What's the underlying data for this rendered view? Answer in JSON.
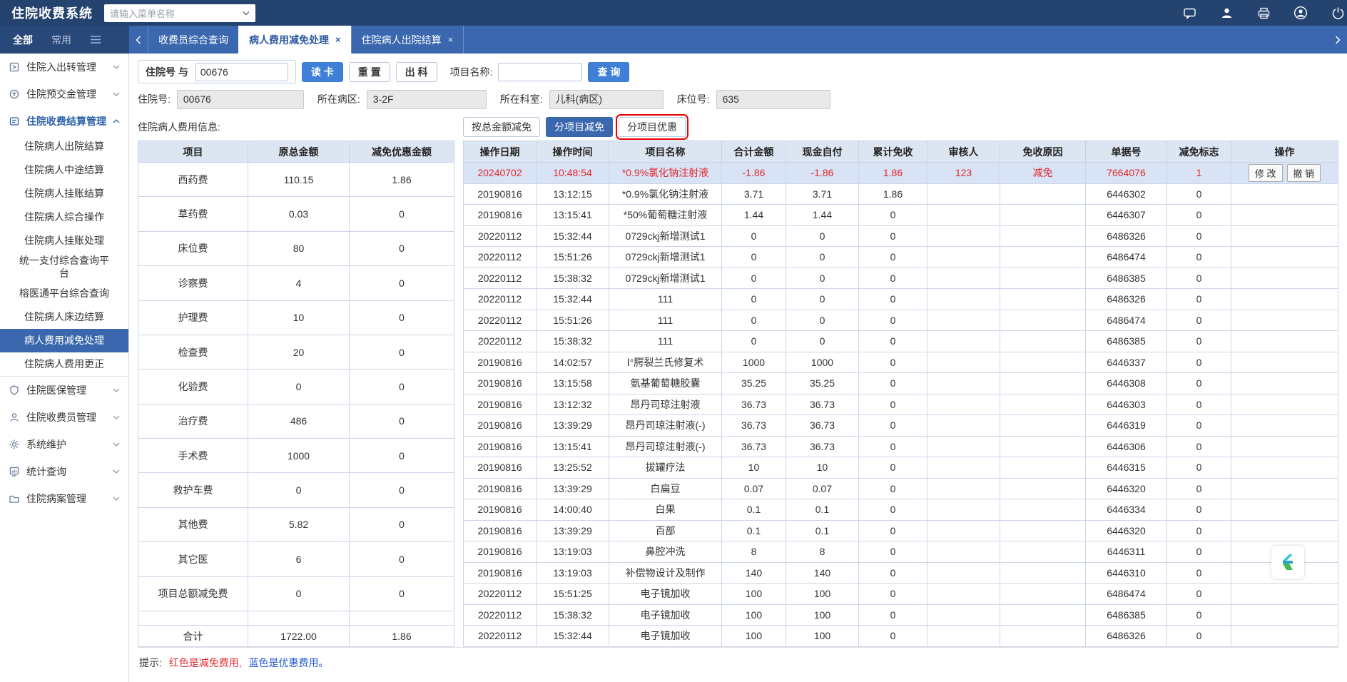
{
  "icons": {
    "close": "×"
  },
  "topbar": {
    "title": "住院收费系统",
    "menu_search_placeholder": "请输入菜单名称",
    "icon_names": [
      "chat-icon",
      "contact-icon",
      "print-icon",
      "user-icon",
      "exit-icon"
    ]
  },
  "tabbar": {
    "filter_tabs": [
      "全部",
      "常用"
    ],
    "tabs": [
      {
        "label": "收费员综合查询",
        "active": false,
        "closable": false
      },
      {
        "label": "病人费用减免处理",
        "active": true,
        "closable": true
      },
      {
        "label": "住院病人出院结算",
        "active": false,
        "closable": true
      }
    ]
  },
  "sidebar": {
    "groups": [
      {
        "label": "住院入出转管理"
      },
      {
        "label": "住院预交金管理"
      },
      {
        "label": "住院收费结算管理",
        "expanded": true
      },
      {
        "label": "住院医保管理"
      },
      {
        "label": "住院收费员管理"
      },
      {
        "label": "系统维护"
      },
      {
        "label": "统计查询"
      },
      {
        "label": "住院病案管理"
      }
    ],
    "subitems": [
      "住院病人出院结算",
      "住院病人中途结算",
      "住院病人挂账结算",
      "住院病人综合操作",
      "住院病人挂账处理",
      "统一支付综合查询平台",
      "榕医通平台综合查询",
      "住院病人床边结算",
      "病人费用减免处理",
      "住院病人费用更正"
    ],
    "active_index": 8
  },
  "toolbar": {
    "admission_label": "住院号 与",
    "admission_value": "00676",
    "read_card": "读 卡",
    "reset": "重 置",
    "discharge": "出 科",
    "item_name_label": "项目名称:",
    "item_name_value": "",
    "query": "查 询"
  },
  "patient": {
    "admission_no_label": "住院号:",
    "admission_no": "00676",
    "ward_label": "所在病区:",
    "ward": "3-2F",
    "dept_label": "所在科室:",
    "dept": "儿科(病区)",
    "bed_label": "床位号:",
    "bed": "635"
  },
  "fee_panel": {
    "title": "住院病人费用信息:",
    "headers": [
      "项目",
      "原总金额",
      "减免优惠金额"
    ],
    "rows": [
      [
        "西药费",
        "110.15",
        "1.86"
      ],
      [
        "草药费",
        "0.03",
        "0"
      ],
      [
        "床位费",
        "80",
        "0"
      ],
      [
        "诊察费",
        "4",
        "0"
      ],
      [
        "护理费",
        "10",
        "0"
      ],
      [
        "检查费",
        "20",
        "0"
      ],
      [
        "化验费",
        "0",
        "0"
      ],
      [
        "治疗费",
        "486",
        "0"
      ],
      [
        "手术费",
        "1000",
        "0"
      ],
      [
        "救护车费",
        "0",
        "0"
      ],
      [
        "其他费",
        "5.82",
        "0"
      ],
      [
        "其它医",
        "6",
        "0"
      ],
      [
        "项目总额减免费",
        "0",
        "0"
      ]
    ],
    "total": [
      "合计",
      "1722.00",
      "1.86"
    ]
  },
  "detail_panel": {
    "mode_buttons": [
      "按总金额减免",
      "分项目减免",
      "分项目优惠"
    ],
    "headers": [
      "操作日期",
      "操作时间",
      "项目名称",
      "合计金额",
      "现金自付",
      "累计免收",
      "审核人",
      "免收原因",
      "单据号",
      "减免标志",
      "操作"
    ],
    "op_labels": [
      "修 改",
      "撤 销"
    ],
    "rows": [
      {
        "selected": true,
        "cells": [
          "20240702",
          "10:48:54",
          "*0.9%氯化钠注射液",
          "-1.86",
          "-1.86",
          "1.86",
          "123",
          "减免",
          "7664076",
          "1"
        ],
        "ops": [
          "修 改",
          "撤 销"
        ]
      },
      {
        "selected": false,
        "cells": [
          "20190816",
          "13:12:15",
          "*0.9%氯化钠注射液",
          "3.71",
          "3.71",
          "1.86",
          "",
          "",
          "6446302",
          "0"
        ],
        "ops": []
      },
      {
        "selected": false,
        "cells": [
          "20190816",
          "13:15:41",
          "*50%葡萄糖注射液",
          "1.44",
          "1.44",
          "0",
          "",
          "",
          "6446307",
          "0"
        ],
        "ops": []
      },
      {
        "selected": false,
        "cells": [
          "20220112",
          "15:32:44",
          "0729ckj新增测试1",
          "0",
          "0",
          "0",
          "",
          "",
          "6486326",
          "0"
        ],
        "ops": []
      },
      {
        "selected": false,
        "cells": [
          "20220112",
          "15:51:26",
          "0729ckj新增测试1",
          "0",
          "0",
          "0",
          "",
          "",
          "6486474",
          "0"
        ],
        "ops": []
      },
      {
        "selected": false,
        "cells": [
          "20220112",
          "15:38:32",
          "0729ckj新增测试1",
          "0",
          "0",
          "0",
          "",
          "",
          "6486385",
          "0"
        ],
        "ops": []
      },
      {
        "selected": false,
        "cells": [
          "20220112",
          "15:32:44",
          "111",
          "0",
          "0",
          "0",
          "",
          "",
          "6486326",
          "0"
        ],
        "ops": []
      },
      {
        "selected": false,
        "cells": [
          "20220112",
          "15:51:26",
          "111",
          "0",
          "0",
          "0",
          "",
          "",
          "6486474",
          "0"
        ],
        "ops": []
      },
      {
        "selected": false,
        "cells": [
          "20220112",
          "15:38:32",
          "111",
          "0",
          "0",
          "0",
          "",
          "",
          "6486385",
          "0"
        ],
        "ops": []
      },
      {
        "selected": false,
        "cells": [
          "20190816",
          "14:02:57",
          "Ⅰ°腭裂兰氏修复术",
          "1000",
          "1000",
          "0",
          "",
          "",
          "6446337",
          "0"
        ],
        "ops": []
      },
      {
        "selected": false,
        "cells": [
          "20190816",
          "13:15:58",
          "氨基葡萄糖胶囊",
          "35.25",
          "35.25",
          "0",
          "",
          "",
          "6446308",
          "0"
        ],
        "ops": []
      },
      {
        "selected": false,
        "cells": [
          "20190816",
          "13:12:32",
          "昂丹司琼注射液",
          "36.73",
          "36.73",
          "0",
          "",
          "",
          "6446303",
          "0"
        ],
        "ops": []
      },
      {
        "selected": false,
        "cells": [
          "20190816",
          "13:39:29",
          "昂丹司琼注射液(-)",
          "36.73",
          "36.73",
          "0",
          "",
          "",
          "6446319",
          "0"
        ],
        "ops": []
      },
      {
        "selected": false,
        "cells": [
          "20190816",
          "13:15:41",
          "昂丹司琼注射液(-)",
          "36.73",
          "36.73",
          "0",
          "",
          "",
          "6446306",
          "0"
        ],
        "ops": []
      },
      {
        "selected": false,
        "cells": [
          "20190816",
          "13:25:52",
          "拔罐疗法",
          "10",
          "10",
          "0",
          "",
          "",
          "6446315",
          "0"
        ],
        "ops": []
      },
      {
        "selected": false,
        "cells": [
          "20190816",
          "13:39:29",
          "白扁豆",
          "0.07",
          "0.07",
          "0",
          "",
          "",
          "6446320",
          "0"
        ],
        "ops": []
      },
      {
        "selected": false,
        "cells": [
          "20190816",
          "14:00:40",
          "白果",
          "0.1",
          "0.1",
          "0",
          "",
          "",
          "6446334",
          "0"
        ],
        "ops": []
      },
      {
        "selected": false,
        "cells": [
          "20190816",
          "13:39:29",
          "百部",
          "0.1",
          "0.1",
          "0",
          "",
          "",
          "6446320",
          "0"
        ],
        "ops": []
      },
      {
        "selected": false,
        "cells": [
          "20190816",
          "13:19:03",
          "鼻腔冲洗",
          "8",
          "8",
          "0",
          "",
          "",
          "6446311",
          "0"
        ],
        "ops": []
      },
      {
        "selected": false,
        "cells": [
          "20190816",
          "13:19:03",
          "补偿物设计及制作",
          "140",
          "140",
          "0",
          "",
          "",
          "6446310",
          "0"
        ],
        "ops": []
      },
      {
        "selected": false,
        "cells": [
          "20220112",
          "15:51:25",
          "电子镜加收",
          "100",
          "100",
          "0",
          "",
          "",
          "6486474",
          "0"
        ],
        "ops": []
      },
      {
        "selected": false,
        "cells": [
          "20220112",
          "15:38:32",
          "电子镜加收",
          "100",
          "100",
          "0",
          "",
          "",
          "6486385",
          "0"
        ],
        "ops": []
      },
      {
        "selected": false,
        "cells": [
          "20220112",
          "15:32:44",
          "电子镜加收",
          "100",
          "100",
          "0",
          "",
          "",
          "6486326",
          "0"
        ],
        "ops": []
      }
    ]
  },
  "hint": {
    "prefix": "提示:",
    "red": "红色是减免费用,",
    "blue": "蓝色是优惠费用。"
  }
}
